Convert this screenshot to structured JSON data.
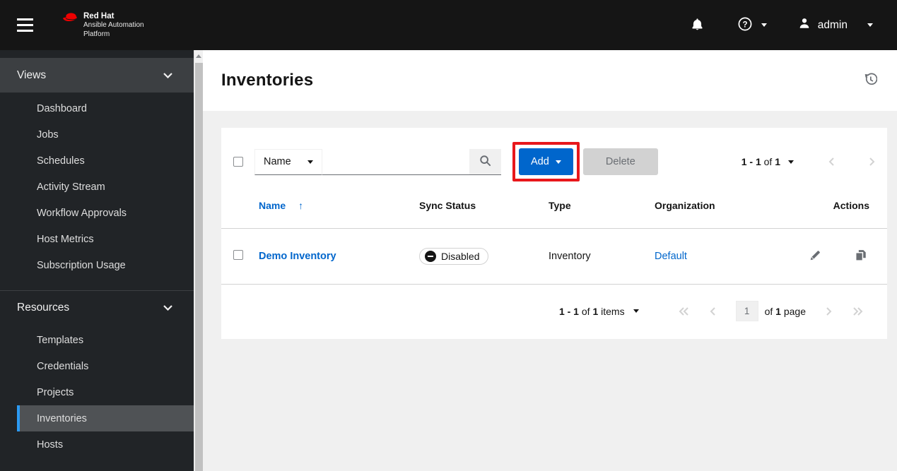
{
  "header": {
    "brand_line1": "Red Hat",
    "brand_line2": "Ansible Automation",
    "brand_line3": "Platform",
    "username": "admin"
  },
  "sidebar": {
    "group_views": {
      "label": "Views",
      "items": [
        "Dashboard",
        "Jobs",
        "Schedules",
        "Activity Stream",
        "Workflow Approvals",
        "Host Metrics",
        "Subscription Usage"
      ]
    },
    "group_resources": {
      "label": "Resources",
      "items": [
        "Templates",
        "Credentials",
        "Projects",
        "Inventories",
        "Hosts"
      ]
    },
    "active_item": "Inventories"
  },
  "page": {
    "title": "Inventories"
  },
  "toolbar": {
    "filter_selected": "Name",
    "search_value": "",
    "add_label": "Add",
    "delete_label": "Delete",
    "pagination_range": "1 - 1",
    "pagination_of": "of",
    "pagination_total": "1"
  },
  "table": {
    "col_name": "Name",
    "sort_arrow": "↑",
    "col_sync": "Sync Status",
    "col_type": "Type",
    "col_org": "Organization",
    "col_actions": "Actions",
    "row": {
      "name": "Demo Inventory",
      "sync_status": "Disabled",
      "type": "Inventory",
      "organization": "Default"
    }
  },
  "footer": {
    "range": "1 - 1",
    "of": "of",
    "total_items": "1",
    "items_label": "items",
    "page_value": "1",
    "of_label": "of",
    "page_total": "1",
    "page_label": "page"
  },
  "colors": {
    "accent_blue": "#0066cc",
    "nav_active_blue": "#2b9af3",
    "annotation_red": "#e8171b",
    "brand_red": "#ee0000",
    "header_bg": "#151515",
    "sidebar_bg": "#212427"
  }
}
